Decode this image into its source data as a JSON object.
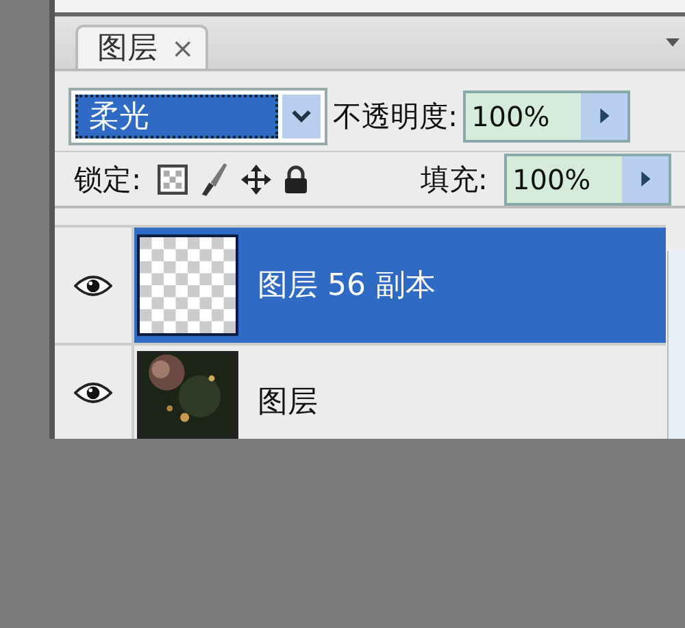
{
  "tab": {
    "label": "图层",
    "close": "×",
    "selected": true
  },
  "blend_mode": {
    "value": "柔光"
  },
  "opacity": {
    "label": "不透明度:",
    "value": "100%"
  },
  "lock": {
    "label": "锁定:"
  },
  "fill": {
    "label": "填充:",
    "value": "100%"
  },
  "layers": [
    {
      "name": "图层 56 副本",
      "kind": "empty",
      "visible": true,
      "selected": true
    },
    {
      "name": "图层",
      "visible": true,
      "selected": false
    }
  ]
}
